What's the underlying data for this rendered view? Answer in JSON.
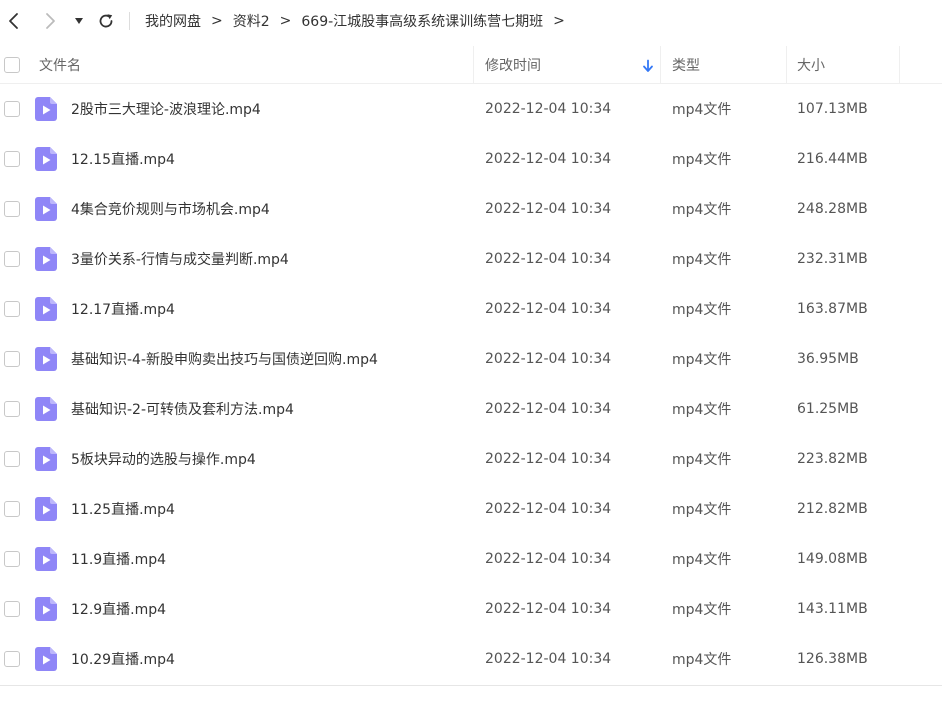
{
  "toolbar": {
    "back_icon": "chevron-left-icon",
    "forward_icon": "chevron-right-icon",
    "dropdown_icon": "caret-down-icon",
    "refresh_icon": "refresh-icon"
  },
  "breadcrumb": {
    "separator": ">",
    "items": [
      {
        "label": "我的网盘"
      },
      {
        "label": "资料2"
      },
      {
        "label": "669-江城股事高级系统课训练营七期班"
      }
    ]
  },
  "table": {
    "columns": {
      "name": "文件名",
      "time": "修改时间",
      "type": "类型",
      "size": "大小"
    },
    "sort_icon": "arrow-down-icon",
    "rows": [
      {
        "name": "2股市三大理论-波浪理论.mp4",
        "time": "2022-12-04 10:34",
        "type": "mp4文件",
        "size": "107.13MB"
      },
      {
        "name": "12.15直播.mp4",
        "time": "2022-12-04 10:34",
        "type": "mp4文件",
        "size": "216.44MB"
      },
      {
        "name": "4集合竞价规则与市场机会.mp4",
        "time": "2022-12-04 10:34",
        "type": "mp4文件",
        "size": "248.28MB"
      },
      {
        "name": "3量价关系-行情与成交量判断.mp4",
        "time": "2022-12-04 10:34",
        "type": "mp4文件",
        "size": "232.31MB"
      },
      {
        "name": "12.17直播.mp4",
        "time": "2022-12-04 10:34",
        "type": "mp4文件",
        "size": "163.87MB"
      },
      {
        "name": "基础知识-4-新股申购卖出技巧与国债逆回购.mp4",
        "time": "2022-12-04 10:34",
        "type": "mp4文件",
        "size": "36.95MB"
      },
      {
        "name": "基础知识-2-可转债及套利方法.mp4",
        "time": "2022-12-04 10:34",
        "type": "mp4文件",
        "size": "61.25MB"
      },
      {
        "name": "5板块异动的选股与操作.mp4",
        "time": "2022-12-04 10:34",
        "type": "mp4文件",
        "size": "223.82MB"
      },
      {
        "name": "11.25直播.mp4",
        "time": "2022-12-04 10:34",
        "type": "mp4文件",
        "size": "212.82MB"
      },
      {
        "name": "11.9直播.mp4",
        "time": "2022-12-04 10:34",
        "type": "mp4文件",
        "size": "149.08MB"
      },
      {
        "name": "12.9直播.mp4",
        "time": "2022-12-04 10:34",
        "type": "mp4文件",
        "size": "143.11MB"
      },
      {
        "name": "10.29直播.mp4",
        "time": "2022-12-04 10:34",
        "type": "mp4文件",
        "size": "126.38MB"
      }
    ]
  },
  "colors": {
    "accent": "#3478f6",
    "file_icon": "#8f86f7",
    "file_icon_fold": "#bdb7fb",
    "divider": "#efefef"
  },
  "file_icon_name": "video-file-icon"
}
